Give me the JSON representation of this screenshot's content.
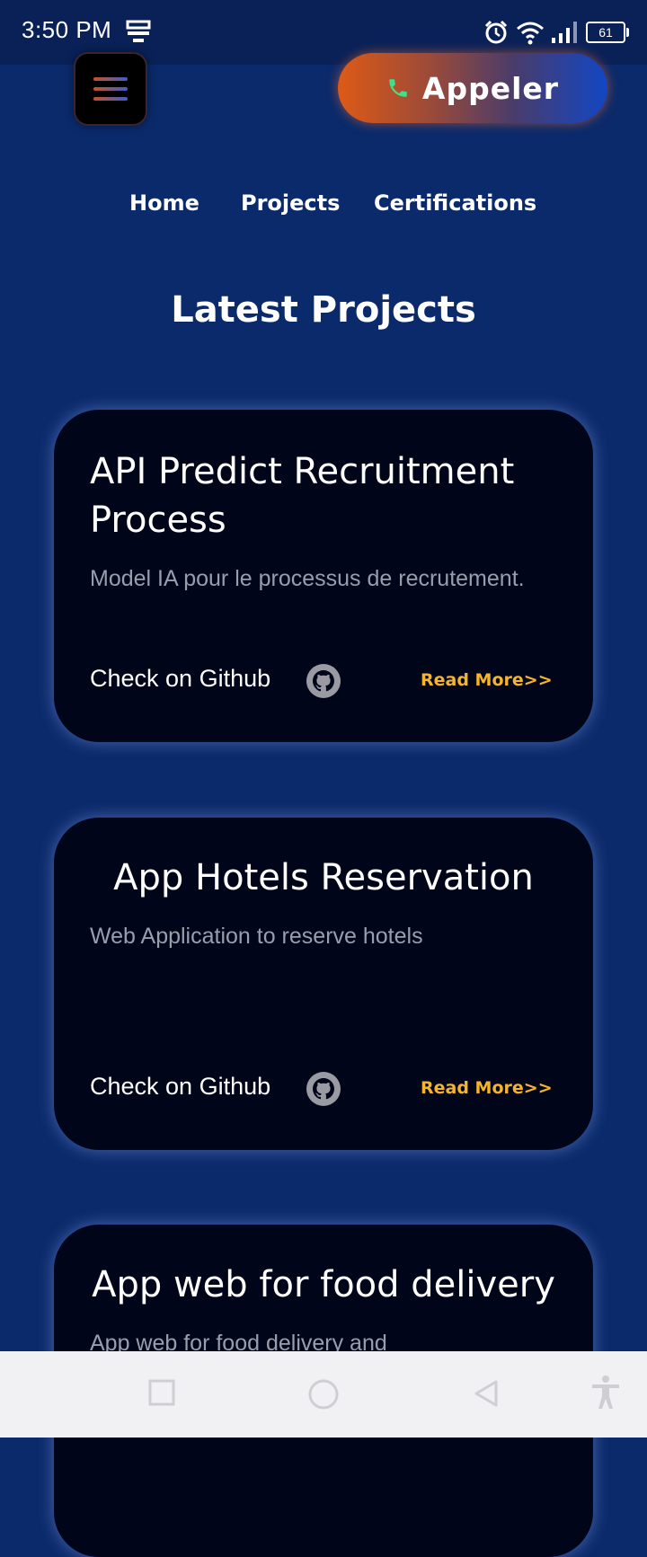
{
  "status_bar": {
    "time": "3:50 PM",
    "battery": "61"
  },
  "header": {
    "call_label": "Appeler"
  },
  "nav": {
    "items": [
      {
        "label": "Home"
      },
      {
        "label": "Projects"
      },
      {
        "label": "Certifications"
      }
    ]
  },
  "section": {
    "title": "Latest Projects"
  },
  "projects": [
    {
      "title": "API Predict Recruitment Process",
      "description": "Model IA pour le processus de recrutement.",
      "github_label": "Check on Github",
      "more_label": "Read More>>"
    },
    {
      "title": "App Hotels Reservation",
      "description": "Web Application to reserve hotels",
      "github_label": "Check on Github",
      "more_label": "Read More>>"
    },
    {
      "title": "App web for food delivery",
      "description": "App web for food delivery and",
      "github_label": "",
      "more_label": ""
    }
  ],
  "colors": {
    "page_bg": "#0b2a6b",
    "card_bg": "#01051a",
    "accent_orange": "#dd5a16",
    "accent_blue": "#1346c4",
    "read_more": "#f5b52a"
  },
  "icons": [
    "menu-icon",
    "phone-icon",
    "github-icon",
    "alarm-icon",
    "wifi-icon",
    "signal-icon",
    "battery-icon",
    "notification-icon",
    "accessibility-icon"
  ]
}
